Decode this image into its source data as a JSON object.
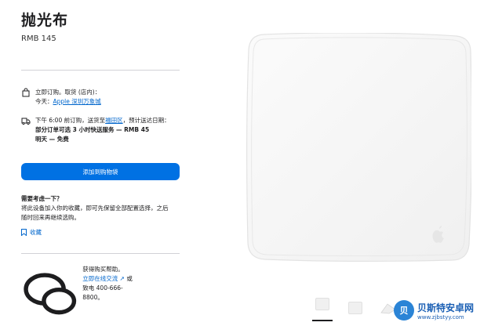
{
  "product": {
    "title": "抛光布",
    "price": "RMB 145"
  },
  "pickup": {
    "line1": "立即订购。取货 (店内)：",
    "day": "今天：",
    "store_link": "Apple 深圳万象城"
  },
  "delivery": {
    "line1_prefix": "下午 6:00 前订购，送货至",
    "line1_link": "福田区",
    "line1_suffix": "，预计送达日期：",
    "line2": "部分订单可选 3 小时快送服务 — RMB 45",
    "line3": "明天 — 免费"
  },
  "add_to_bag": {
    "label": "添加到购物袋"
  },
  "consider": {
    "heading": "需要考虑一下？",
    "line1": "将此设备加入你的收藏，即可先保留全部配置选择，之后",
    "line2": "随时回来再继续选购。",
    "save_label": "收藏"
  },
  "help": {
    "heading": "获得购买帮助。",
    "chat_link": "立即在线交流 ↗",
    "phone_text": " 或致电 400-666-8800。"
  },
  "watermark": {
    "logo_text": "贝",
    "brand": "贝斯特安卓网",
    "url": "www.zjbstyy.com"
  },
  "colors": {
    "accent": "#0071e3",
    "link": "#0066cc"
  }
}
